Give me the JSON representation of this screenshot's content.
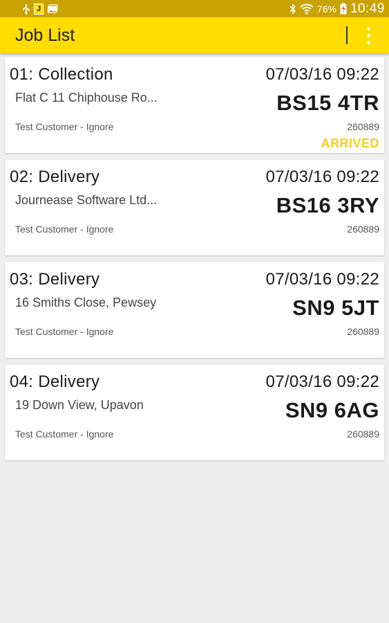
{
  "status_bar": {
    "battery": "76%",
    "clock": "10:49",
    "app_badge": "J",
    "icons": [
      "usb-icon",
      "j-app-icon",
      "gallery-icon",
      "bluetooth-icon",
      "wifi-icon",
      "battery-icon"
    ]
  },
  "app_bar": {
    "title": "Job List",
    "menu_icon": "more-vert-icon"
  },
  "jobs": [
    {
      "title": "01:  Collection",
      "address": "Flat C 11 Chiphouse Ro...",
      "customer": "Test Customer - Ignore",
      "datetime": "07/03/16 09:22",
      "postcode": "BS15 4TR",
      "ref": "260889",
      "status": "ARRIVED"
    },
    {
      "title": "02:  Delivery",
      "address": "Journease Software Ltd...",
      "customer": "Test Customer - Ignore",
      "datetime": "07/03/16 09:22",
      "postcode": "BS16 3RY",
      "ref": "260889",
      "status": ""
    },
    {
      "title": "03:  Delivery",
      "address": "16 Smiths Close, Pewsey",
      "customer": "Test Customer - Ignore",
      "datetime": "07/03/16 09:22",
      "postcode": "SN9 5JT",
      "ref": "260889",
      "status": ""
    },
    {
      "title": "04:  Delivery",
      "address": "19 Down View, Upavon",
      "customer": "Test Customer - Ignore",
      "datetime": "07/03/16 09:22",
      "postcode": "SN9 6AG",
      "ref": "260889",
      "status": ""
    }
  ],
  "colors": {
    "app_bar": "#ffdd00",
    "status_bar": "#c9a300",
    "arrived": "#f5cf1e",
    "background": "#eeeeee"
  }
}
